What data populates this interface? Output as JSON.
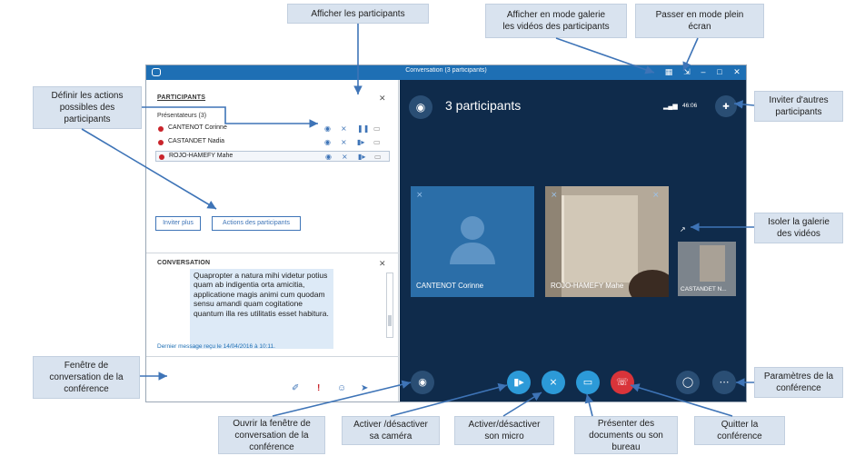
{
  "callouts": {
    "show_participants": "Afficher les participants",
    "gallery_mode": "Afficher en mode galerie\nles vidéos des participants",
    "full_screen": "Passer en mode plein\nécran",
    "define_actions": "Définir les actions\npossibles des\nparticipants",
    "invite_others": "Inviter d'autres\nparticipants",
    "isolate_gallery": "Isoler la galerie\ndes vidéos",
    "conversation_window": "Fenêtre de\nconversation de la\nconférence",
    "settings": "Paramètres de la\nconférence",
    "open_chat": "Ouvrir la fenêtre de\nconversation de la\nconférence",
    "toggle_camera": "Activer /désactiver\nsa caméra",
    "toggle_mic": "Activer/désactiver\nson micro",
    "present": "Présenter des\ndocuments ou son\nbureau",
    "quit": "Quitter la\nconférence"
  },
  "window": {
    "title": "Conversation (3 participants)"
  },
  "participants_panel": {
    "heading": "PARTICIPANTS",
    "presenters_label": "Présentateurs (3)",
    "people": [
      {
        "name": "CANTENOT Corinne"
      },
      {
        "name": "CASTANDET Nadia"
      },
      {
        "name": "ROJO-HAMEFY Mahe"
      }
    ],
    "invite_more_label": "Inviter plus",
    "participant_actions_label": "Actions des participants"
  },
  "conversation_panel": {
    "heading": "CONVERSATION",
    "message": "Quapropter a natura mihi videtur potius quam ab indigentia orta amicitia, applicatione magis animi cum quodam sensu amandi quam cogitatione quantum illa res utilitatis esset habitura.",
    "last_message": "Dernier message reçu le 14/04/2016 à 10:11."
  },
  "video": {
    "participant_count_label": "3 participants",
    "timer": "46:06",
    "tiles": [
      {
        "name": "CANTENOT Corinne"
      },
      {
        "name": "ROJO-HAMEFY Mahe"
      },
      {
        "name": "CASTANDET N..."
      }
    ]
  },
  "colors": {
    "callout_bg": "#d9e3ef",
    "titlebar": "#1e6fb4",
    "video_bg": "#0f2b4b",
    "control_blue": "#2c9ad8",
    "hangup_red": "#d9343a",
    "presence_red": "#c9242b",
    "arrow": "#3e74b7"
  },
  "icons": [
    "people-icon",
    "invite-icon",
    "chat-icon",
    "camera-icon",
    "mic-icon",
    "present-icon",
    "hangup-icon",
    "devices-icon",
    "more-icon",
    "gallery-icon",
    "fullscreen-icon",
    "minimize-icon",
    "maximize-icon",
    "close-icon",
    "paperclip-icon",
    "important-icon",
    "emoji-icon",
    "send-icon",
    "signal-icon"
  ]
}
